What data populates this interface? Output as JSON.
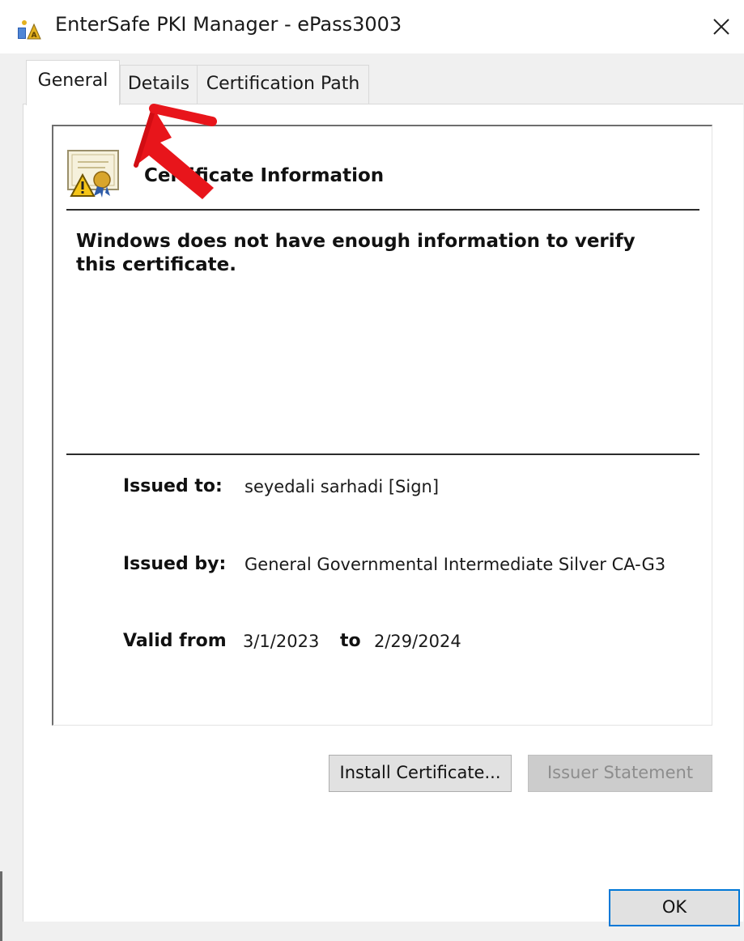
{
  "window": {
    "title": "EnterSafe PKI Manager - ePass3003",
    "close_icon": "close-icon"
  },
  "tabs": [
    {
      "label": "General",
      "selected": true
    },
    {
      "label": "Details",
      "selected": false
    },
    {
      "label": "Certification Path",
      "selected": false
    }
  ],
  "cert": {
    "heading": "Certificate Information",
    "warning": "Windows does not have enough information to verify this certificate.",
    "issued_to_label": "Issued to:",
    "issued_to_value": "seyedali sarhadi [Sign]",
    "issued_by_label": "Issued by:",
    "issued_by_value": "General Governmental Intermediate Silver CA-G3",
    "valid_from_label": "Valid from",
    "valid_from_value": "3/1/2023",
    "to_label": "to",
    "valid_to_value": "2/29/2024",
    "icon": "certificate-warning-icon"
  },
  "buttons": {
    "install": "Install Certificate...",
    "issuer_statement": "Issuer Statement",
    "ok": "OK"
  },
  "annotation": {
    "icon": "red-arrow-annotation",
    "color": "#e8151b"
  }
}
